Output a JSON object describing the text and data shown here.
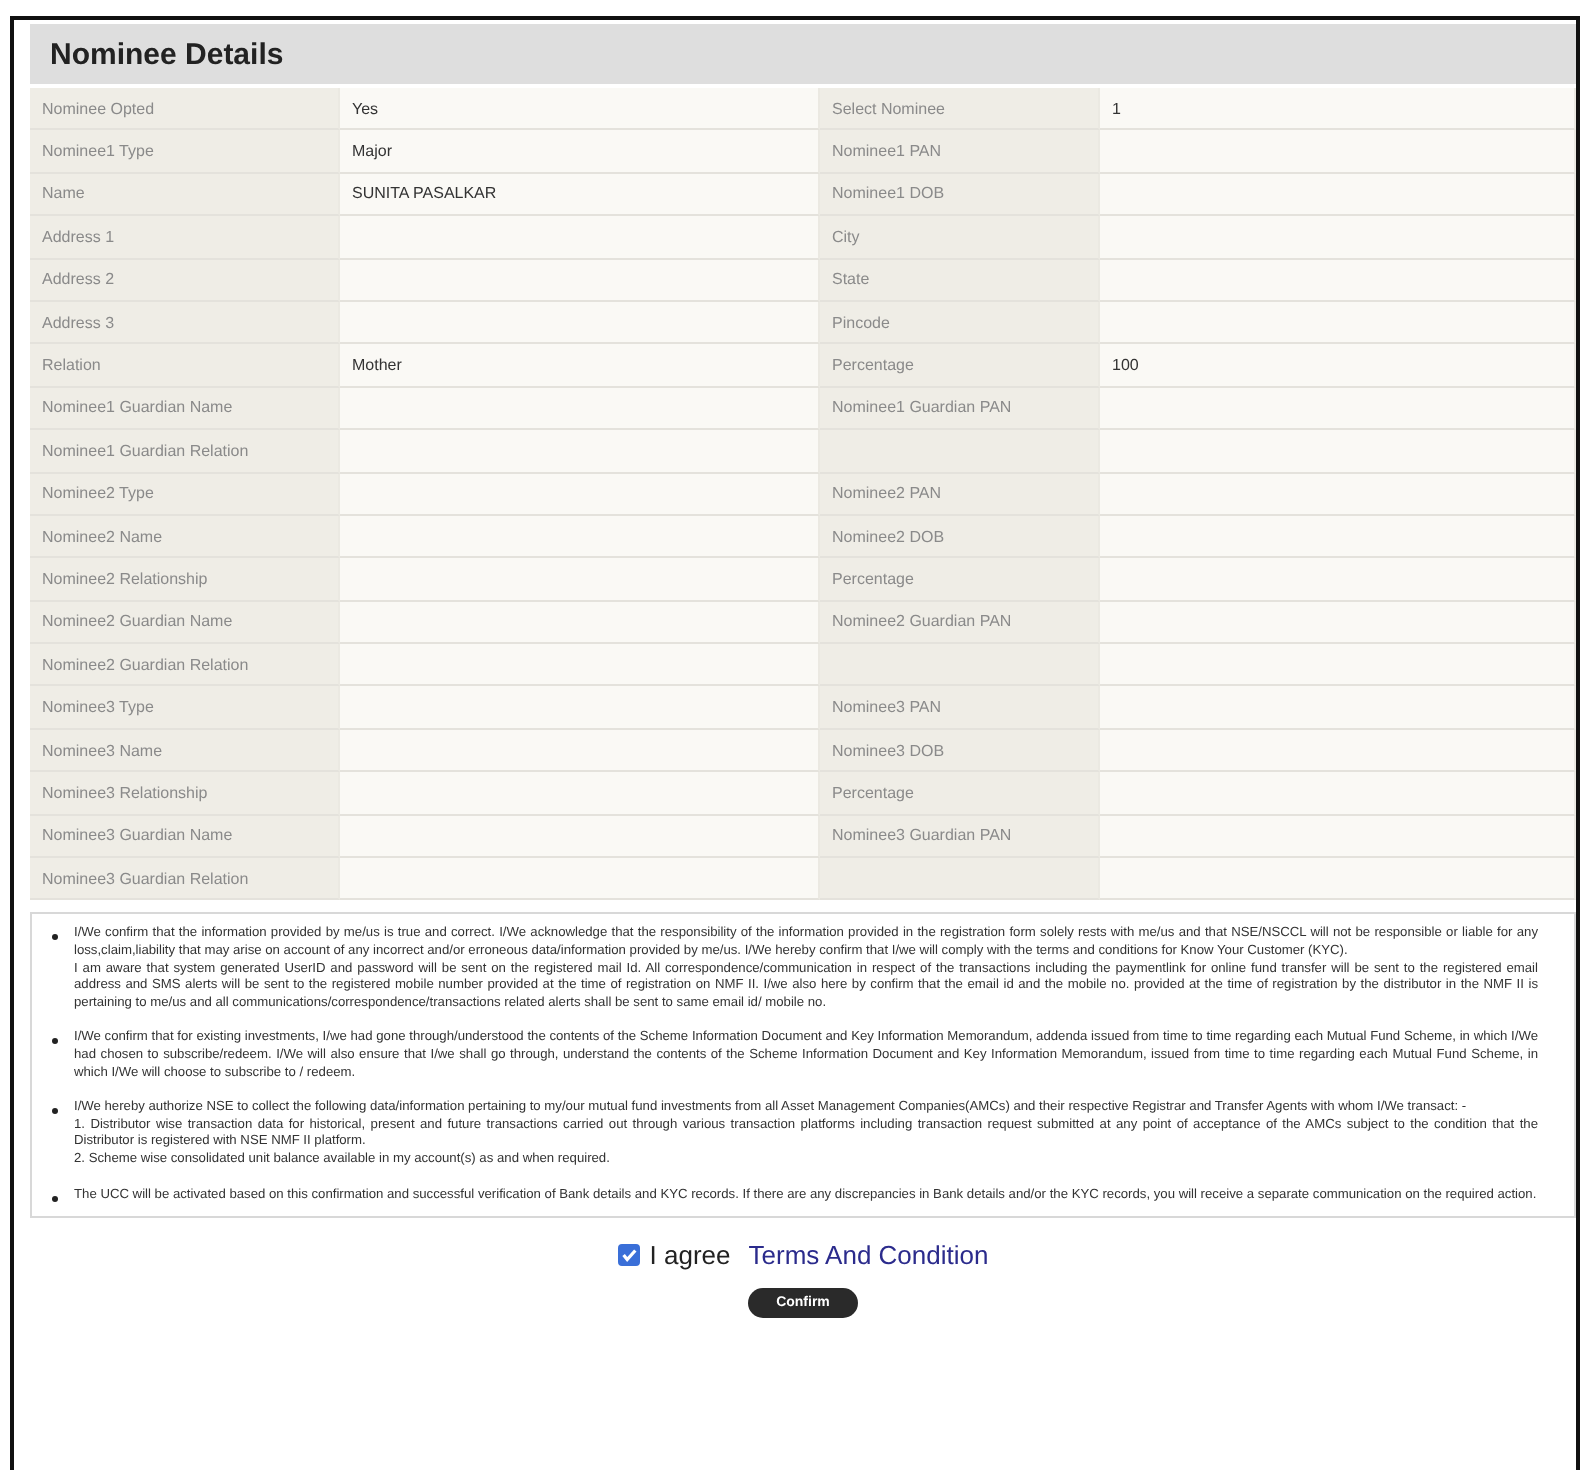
{
  "title": "Nominee Details",
  "rows": [
    {
      "label": "Nominee Opted",
      "value": "Yes",
      "label2": "Select Nominee",
      "value2": "1"
    },
    {
      "label": "Nominee1 Type",
      "value": "Major",
      "label2": "Nominee1 PAN"
    },
    {
      "label": "Name",
      "value": "SUNITA PASALKAR",
      "label2": "Nominee1 DOB"
    },
    {
      "label": "Address 1",
      "label2": "City"
    },
    {
      "label": "Address 2",
      "label2": "State"
    },
    {
      "label": "Address 3",
      "label2": "Pincode"
    },
    {
      "label": "Relation",
      "value": "Mother",
      "label2": "Percentage",
      "value2": "100"
    },
    {
      "label": "Nominee1 Guardian Name",
      "label2": "Nominee1 Guardian PAN"
    },
    {
      "label": "Nominee1 Guardian Relation"
    },
    {
      "label": "Nominee2 Type",
      "label2": "Nominee2 PAN"
    },
    {
      "label": "Nominee2 Name",
      "label2": "Nominee2 DOB"
    },
    {
      "label": "Nominee2 Relationship",
      "label2": "Percentage"
    },
    {
      "label": "Nominee2 Guardian Name",
      "label2": "Nominee2 Guardian PAN"
    },
    {
      "label": "Nominee2 Guardian Relation"
    },
    {
      "label": "Nominee3 Type",
      "label2": "Nominee3 PAN"
    },
    {
      "label": "Nominee3 Name",
      "label2": "Nominee3 DOB"
    },
    {
      "label": "Nominee3 Relationship",
      "label2": "Percentage"
    },
    {
      "label": "Nominee3 Guardian Name",
      "label2": "Nominee3 Guardian PAN"
    },
    {
      "label": "Nominee3 Guardian Relation"
    }
  ],
  "terms": [
    {
      "lines": [
        "I/We confirm that the information provided by me/us is true and correct. I/We acknowledge that the responsibility of the information provided in the registration form solely rests with me/us and that NSE/NSCCL will not be responsible or liable for any loss,claim,liability that may arise on account of any incorrect and/or erroneous data/information provided by me/us. I/We hereby confirm that I/we will comply with the terms and conditions for Know Your Customer (KYC).",
        "I am aware that system generated UserID and password will be sent on the registered mail Id. All correspondence/communication in respect of the transactions including the paymentlink for online fund transfer will be sent to the registered email address and SMS alerts will be sent to the registered mobile number provided at the time of registration on NMF II. I/we also here by confirm that the email id and the mobile no. provided at the time of registration by the distributor in the NMF II is pertaining to me/us and all communications/correspondence/transactions related alerts shall be sent to same email id/ mobile no."
      ]
    },
    {
      "lines": [
        "I/We confirm that for existing investments, I/we had gone through/understood the contents of the Scheme Information Document and Key Information Memorandum, addenda issued from time to time regarding each Mutual Fund Scheme, in which I/We had chosen to subscribe/redeem. I/We will also ensure that I/we shall go through, understand the contents of the Scheme Information Document and Key Information Memorandum, issued from time to time regarding each Mutual Fund Scheme, in which I/We will choose to subscribe to / redeem."
      ]
    },
    {
      "lines": [
        "I/We hereby authorize NSE to collect the following data/information pertaining to my/our mutual fund investments from all Asset Management Companies(AMCs) and their respective Registrar and Transfer Agents with whom I/We transact: -",
        "1. Distributor wise transaction data for historical, present and future transactions carried out through various transaction platforms including transaction request submitted at any point of acceptance of the AMCs subject to the condition that the Distributor is registered with NSE NMF II platform.",
        "2. Scheme wise consolidated unit balance available in my account(s) as and when required."
      ]
    },
    {
      "lines": [
        "The UCC will be activated based on this confirmation and successful verification of Bank details and KYC records. If there are any discrepancies in Bank details and/or the KYC records, you will receive a separate communication on the required action."
      ]
    }
  ],
  "agree": {
    "checked": true,
    "label": "I agree",
    "link": "Terms And Condition"
  },
  "button": "Confirm"
}
